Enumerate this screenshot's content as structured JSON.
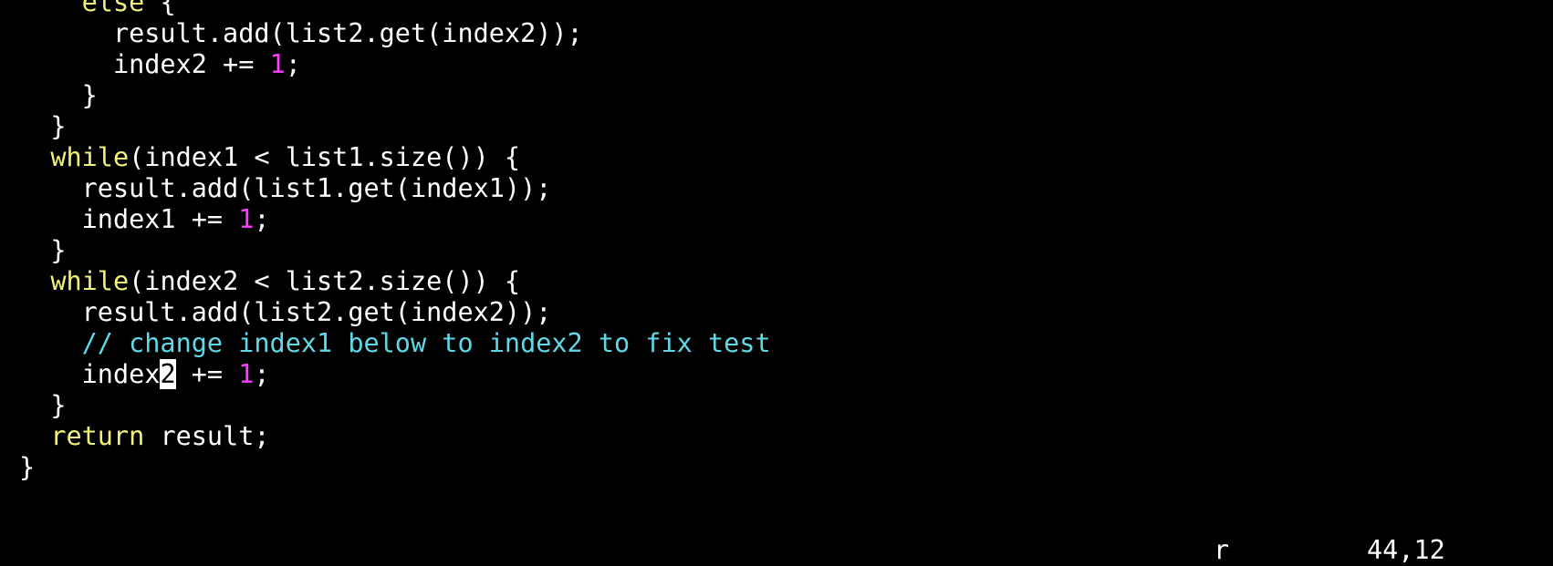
{
  "editor": {
    "lines": [
      {
        "indent": "    ",
        "keyword": "else",
        "rest": " {"
      },
      {
        "indent": "      ",
        "text": "result.add(list2.get(index2));"
      },
      {
        "indent": "      ",
        "pre": "index2 += ",
        "num": "1",
        "post": ";"
      },
      {
        "indent": "    ",
        "text": "}"
      },
      {
        "indent": "  ",
        "text": "}"
      },
      {
        "indent": "  ",
        "keyword": "while",
        "rest": "(index1 < list1.size()) {"
      },
      {
        "indent": "    ",
        "text": "result.add(list1.get(index1));"
      },
      {
        "indent": "    ",
        "pre": "index1 += ",
        "num": "1",
        "post": ";"
      },
      {
        "indent": "  ",
        "text": "}"
      },
      {
        "indent": "  ",
        "keyword": "while",
        "rest": "(index2 < list2.size()) {"
      },
      {
        "indent": "    ",
        "text": "result.add(list2.get(index2));"
      },
      {
        "indent": "    ",
        "comment": "// change index1 below to index2 to fix test"
      },
      {
        "indent": "    ",
        "pre": "index",
        "cursor_char": "2",
        "mid": " += ",
        "num": "1",
        "post": ";"
      },
      {
        "indent": "  ",
        "text": "}"
      },
      {
        "indent": "  ",
        "keyword": "return",
        "rest": " result;"
      },
      {
        "indent": "",
        "text": "}"
      }
    ]
  },
  "status": {
    "mode": "r",
    "position": "44,12"
  },
  "colors": {
    "background": "#000000",
    "text": "#ffffff",
    "keyword": "#f2f27a",
    "number": "#ff3dff",
    "comment": "#5fd9e6"
  }
}
